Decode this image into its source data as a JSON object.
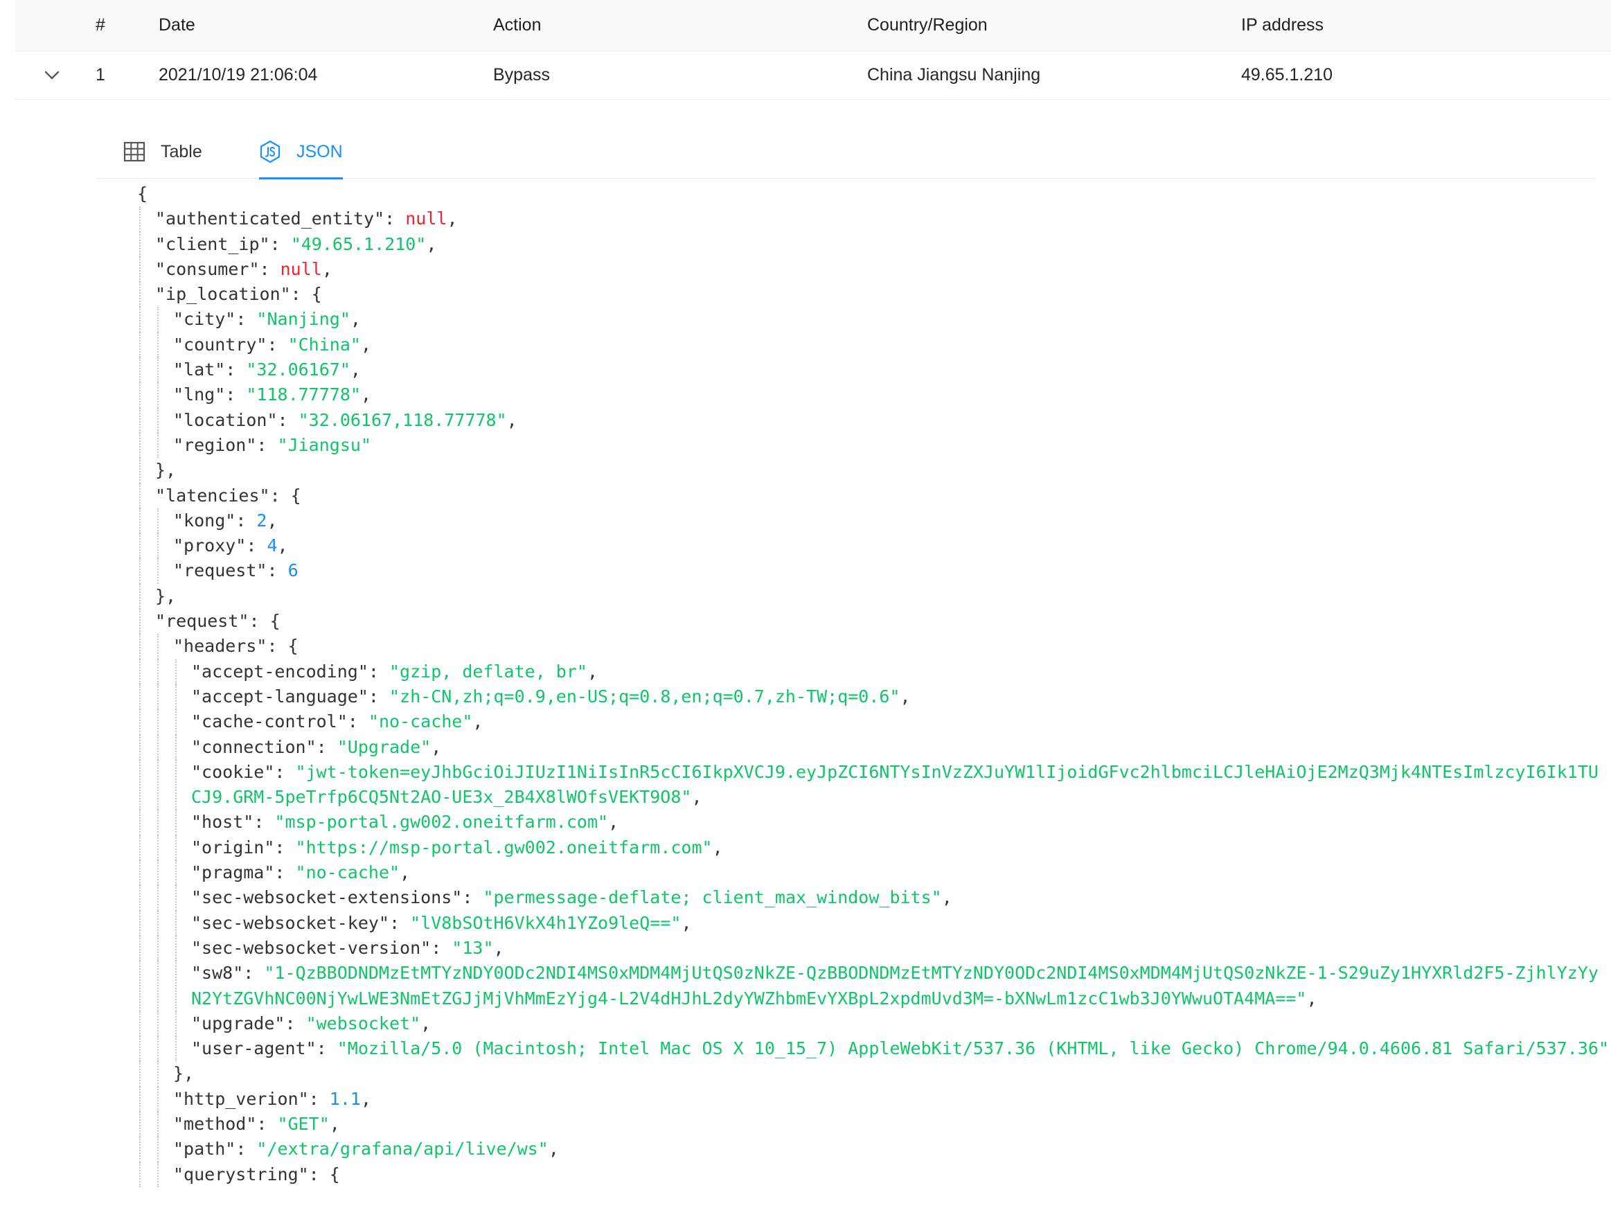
{
  "table": {
    "columns": [
      "#",
      "Date",
      "Action",
      "Country/Region",
      "IP address"
    ],
    "rows": [
      {
        "num": "1",
        "date": "2021/10/19 21:06:04",
        "action": "Bypass",
        "country": "China Jiangsu Nanjing",
        "ip": "49.65.1.210"
      }
    ]
  },
  "tabs": [
    {
      "label": "Table",
      "icon": "table-grid-icon",
      "active": false
    },
    {
      "label": "JSON",
      "icon": "js-hex-icon",
      "active": true
    }
  ],
  "colors": {
    "accent": "#1890ff",
    "json_string": "#10c56a",
    "json_number": "#1a8ff2",
    "json_null": "#f5222d"
  },
  "json_lines": [
    {
      "d": 0,
      "t": [
        [
          "p",
          "{"
        ]
      ]
    },
    {
      "d": 1,
      "t": [
        [
          "k",
          "\"authenticated_entity\""
        ],
        [
          "p",
          ": "
        ],
        [
          "nl",
          "null"
        ],
        [
          "p",
          ","
        ]
      ]
    },
    {
      "d": 1,
      "t": [
        [
          "k",
          "\"client_ip\""
        ],
        [
          "p",
          ": "
        ],
        [
          "s",
          "\"49.65.1.210\""
        ],
        [
          "p",
          ","
        ]
      ]
    },
    {
      "d": 1,
      "t": [
        [
          "k",
          "\"consumer\""
        ],
        [
          "p",
          ": "
        ],
        [
          "nl",
          "null"
        ],
        [
          "p",
          ","
        ]
      ]
    },
    {
      "d": 1,
      "t": [
        [
          "k",
          "\"ip_location\""
        ],
        [
          "p",
          ": {"
        ]
      ]
    },
    {
      "d": 2,
      "t": [
        [
          "k",
          "\"city\""
        ],
        [
          "p",
          ": "
        ],
        [
          "s",
          "\"Nanjing\""
        ],
        [
          "p",
          ","
        ]
      ]
    },
    {
      "d": 2,
      "t": [
        [
          "k",
          "\"country\""
        ],
        [
          "p",
          ": "
        ],
        [
          "s",
          "\"China\""
        ],
        [
          "p",
          ","
        ]
      ]
    },
    {
      "d": 2,
      "t": [
        [
          "k",
          "\"lat\""
        ],
        [
          "p",
          ": "
        ],
        [
          "s",
          "\"32.06167\""
        ],
        [
          "p",
          ","
        ]
      ]
    },
    {
      "d": 2,
      "t": [
        [
          "k",
          "\"lng\""
        ],
        [
          "p",
          ": "
        ],
        [
          "s",
          "\"118.77778\""
        ],
        [
          "p",
          ","
        ]
      ]
    },
    {
      "d": 2,
      "t": [
        [
          "k",
          "\"location\""
        ],
        [
          "p",
          ": "
        ],
        [
          "s",
          "\"32.06167,118.77778\""
        ],
        [
          "p",
          ","
        ]
      ]
    },
    {
      "d": 2,
      "t": [
        [
          "k",
          "\"region\""
        ],
        [
          "p",
          ": "
        ],
        [
          "s",
          "\"Jiangsu\""
        ]
      ]
    },
    {
      "d": 1,
      "t": [
        [
          "p",
          "},"
        ]
      ]
    },
    {
      "d": 1,
      "t": [
        [
          "k",
          "\"latencies\""
        ],
        [
          "p",
          ": {"
        ]
      ]
    },
    {
      "d": 2,
      "t": [
        [
          "k",
          "\"kong\""
        ],
        [
          "p",
          ": "
        ],
        [
          "n",
          "2"
        ],
        [
          "p",
          ","
        ]
      ]
    },
    {
      "d": 2,
      "t": [
        [
          "k",
          "\"proxy\""
        ],
        [
          "p",
          ": "
        ],
        [
          "n",
          "4"
        ],
        [
          "p",
          ","
        ]
      ]
    },
    {
      "d": 2,
      "t": [
        [
          "k",
          "\"request\""
        ],
        [
          "p",
          ": "
        ],
        [
          "n",
          "6"
        ]
      ]
    },
    {
      "d": 1,
      "t": [
        [
          "p",
          "},"
        ]
      ]
    },
    {
      "d": 1,
      "t": [
        [
          "k",
          "\"request\""
        ],
        [
          "p",
          ": {"
        ]
      ]
    },
    {
      "d": 2,
      "t": [
        [
          "k",
          "\"headers\""
        ],
        [
          "p",
          ": {"
        ]
      ]
    },
    {
      "d": 3,
      "t": [
        [
          "k",
          "\"accept-encoding\""
        ],
        [
          "p",
          ": "
        ],
        [
          "s",
          "\"gzip, deflate, br\""
        ],
        [
          "p",
          ","
        ]
      ]
    },
    {
      "d": 3,
      "t": [
        [
          "k",
          "\"accept-language\""
        ],
        [
          "p",
          ": "
        ],
        [
          "s",
          "\"zh-CN,zh;q=0.9,en-US;q=0.8,en;q=0.7,zh-TW;q=0.6\""
        ],
        [
          "p",
          ","
        ]
      ]
    },
    {
      "d": 3,
      "t": [
        [
          "k",
          "\"cache-control\""
        ],
        [
          "p",
          ": "
        ],
        [
          "s",
          "\"no-cache\""
        ],
        [
          "p",
          ","
        ]
      ]
    },
    {
      "d": 3,
      "t": [
        [
          "k",
          "\"connection\""
        ],
        [
          "p",
          ": "
        ],
        [
          "s",
          "\"Upgrade\""
        ],
        [
          "p",
          ","
        ]
      ]
    },
    {
      "d": 3,
      "wrap": true,
      "t": [
        [
          "k",
          "\"cookie\""
        ],
        [
          "p",
          ": "
        ],
        [
          "s",
          "\"jwt-token=eyJhbGciOiJIUzI1NiIsInR5cCI6IkpXVCJ9.eyJpZCI6NTYsInVzZXJuYW1lIjoidGFvc2hlbmciLCJleHAiOjE2MzQ3Mjk4NTEsImlzcyI6Ik1TUCJ9.GRM-5peTrfp6CQ5Nt2AO-UE3x_2B4X8lWOfsVEKT9O8\""
        ],
        [
          "p",
          ","
        ]
      ]
    },
    {
      "d": 3,
      "t": [
        [
          "k",
          "\"host\""
        ],
        [
          "p",
          ": "
        ],
        [
          "s",
          "\"msp-portal.gw002.oneitfarm.com\""
        ],
        [
          "p",
          ","
        ]
      ]
    },
    {
      "d": 3,
      "t": [
        [
          "k",
          "\"origin\""
        ],
        [
          "p",
          ": "
        ],
        [
          "s",
          "\"https://msp-portal.gw002.oneitfarm.com\""
        ],
        [
          "p",
          ","
        ]
      ]
    },
    {
      "d": 3,
      "t": [
        [
          "k",
          "\"pragma\""
        ],
        [
          "p",
          ": "
        ],
        [
          "s",
          "\"no-cache\""
        ],
        [
          "p",
          ","
        ]
      ]
    },
    {
      "d": 3,
      "t": [
        [
          "k",
          "\"sec-websocket-extensions\""
        ],
        [
          "p",
          ": "
        ],
        [
          "s",
          "\"permessage-deflate; client_max_window_bits\""
        ],
        [
          "p",
          ","
        ]
      ]
    },
    {
      "d": 3,
      "t": [
        [
          "k",
          "\"sec-websocket-key\""
        ],
        [
          "p",
          ": "
        ],
        [
          "s",
          "\"lV8bSOtH6VkX4h1YZo9leQ==\""
        ],
        [
          "p",
          ","
        ]
      ]
    },
    {
      "d": 3,
      "t": [
        [
          "k",
          "\"sec-websocket-version\""
        ],
        [
          "p",
          ": "
        ],
        [
          "s",
          "\"13\""
        ],
        [
          "p",
          ","
        ]
      ]
    },
    {
      "d": 3,
      "wrap": true,
      "t": [
        [
          "k",
          "\"sw8\""
        ],
        [
          "p",
          ": "
        ],
        [
          "s",
          "\"1-QzBBODNDMzEtMTYzNDY0ODc2NDI4MS0xMDM4MjUtQS0zNkZE-QzBBODNDMzEtMTYzNDY0ODc2NDI4MS0xMDM4MjUtQS0zNkZE-1-S29uZy1HYXRld2F5-ZjhlYzYyN2YtZGVhNC00NjYwLWE3NmEtZGJjMjVhMmEzYjg4-L2V4dHJhL2dyYWZhbmEvYXBpL2xpdmUvd3M=-bXNwLm1zcC1wb3J0YWwuOTA4MA==\""
        ],
        [
          "p",
          ","
        ]
      ]
    },
    {
      "d": 3,
      "t": [
        [
          "k",
          "\"upgrade\""
        ],
        [
          "p",
          ": "
        ],
        [
          "s",
          "\"websocket\""
        ],
        [
          "p",
          ","
        ]
      ]
    },
    {
      "d": 3,
      "t": [
        [
          "k",
          "\"user-agent\""
        ],
        [
          "p",
          ": "
        ],
        [
          "s",
          "\"Mozilla/5.0 (Macintosh; Intel Mac OS X 10_15_7) AppleWebKit/537.36 (KHTML, like Gecko) Chrome/94.0.4606.81 Safari/537.36\""
        ]
      ]
    },
    {
      "d": 2,
      "t": [
        [
          "p",
          "},"
        ]
      ]
    },
    {
      "d": 2,
      "t": [
        [
          "k",
          "\"http_verion\""
        ],
        [
          "p",
          ": "
        ],
        [
          "n",
          "1.1"
        ],
        [
          "p",
          ","
        ]
      ]
    },
    {
      "d": 2,
      "t": [
        [
          "k",
          "\"method\""
        ],
        [
          "p",
          ": "
        ],
        [
          "s",
          "\"GET\""
        ],
        [
          "p",
          ","
        ]
      ]
    },
    {
      "d": 2,
      "t": [
        [
          "k",
          "\"path\""
        ],
        [
          "p",
          ": "
        ],
        [
          "s",
          "\"/extra/grafana/api/live/ws\""
        ],
        [
          "p",
          ","
        ]
      ]
    },
    {
      "d": 2,
      "t": [
        [
          "k",
          "\"querystring\""
        ],
        [
          "p",
          ": {"
        ]
      ]
    }
  ]
}
